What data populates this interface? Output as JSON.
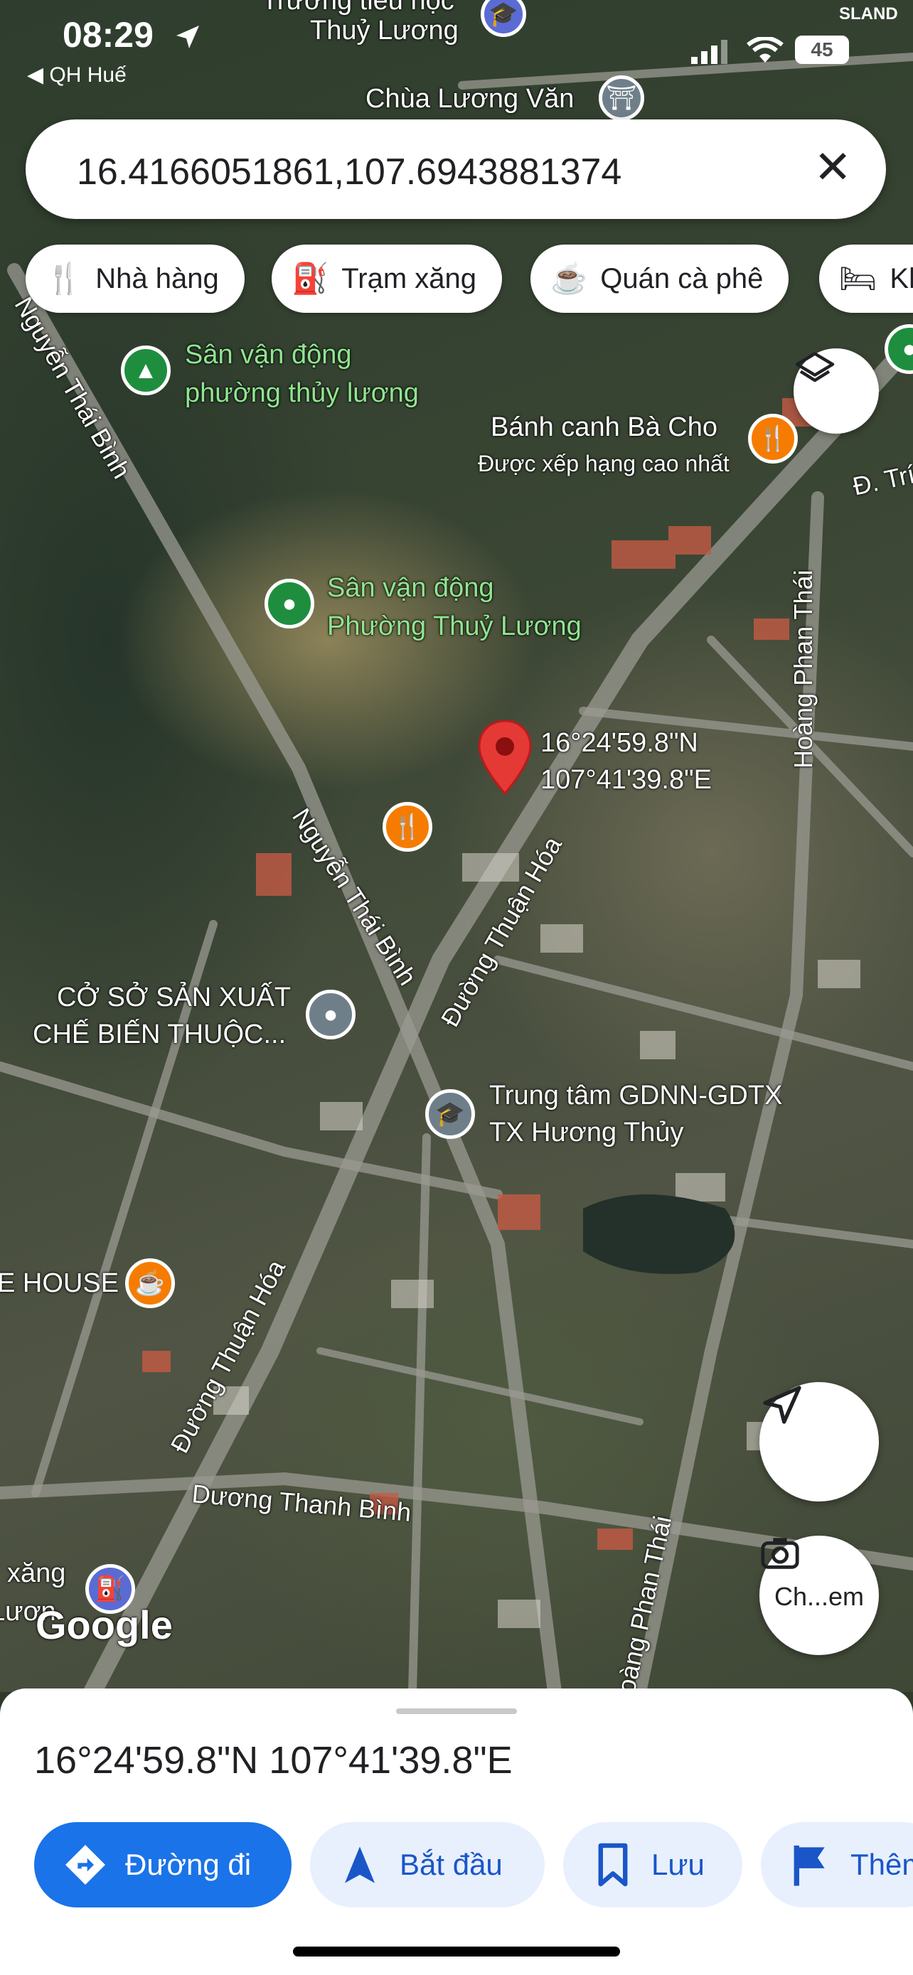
{
  "status_bar": {
    "time": "08:29",
    "back_app": "QH Huế",
    "battery": "45",
    "brand": "SLAND"
  },
  "search": {
    "query": "16.4166051861,107.6943881374"
  },
  "chips": [
    {
      "label": "Nhà hàng",
      "icon": "restaurant-icon"
    },
    {
      "label": "Trạm xăng",
      "icon": "gas-station-icon"
    },
    {
      "label": "Quán cà phê",
      "icon": "coffee-icon"
    },
    {
      "label": "Kh",
      "icon": "hotel-icon"
    }
  ],
  "map": {
    "labels": {
      "school_top": "Trường tiểu học",
      "school_top2": "Thuỷ Lương",
      "pagoda": "Chùa Lương Văn",
      "stadium1_l1": "Sân vận động",
      "stadium1_l2": "phường thủy lương",
      "restaurant": "Bánh canh Bà Cho",
      "restaurant_sub": "Được xếp hạng cao nhất",
      "stadium2_l1": "Sân vận động",
      "stadium2_l2": "Phường Thuỷ Lương",
      "pin_lat": "16°24'59.8\"N",
      "pin_lng": "107°41'39.8\"E",
      "factory_l1": "CỞ SỞ SẢN XUẤT",
      "factory_l2": "CHẾ BIẾN THUỘC...",
      "training_l1": "Trung tâm GDNN-GDTX",
      "training_l2": "TX Hương Thủy",
      "house": "E HOUSE",
      "gas": "xăng",
      "gas2": "Lươn",
      "google": "Google"
    },
    "roads": {
      "nguyen_thai_binh": "Nguyễn Thái Bình",
      "nguyen_thai_binh_2": "Nguyễn Thái Bình",
      "thuan_hoa": "Đường Thuận Hóa",
      "thuan_hoa_2": "Đường Thuận Hóa",
      "hoang_phan_thai": "Hoàng Phan Thái",
      "hoang_phan_thai_2": "oàng Phan Thái",
      "duong_thanh_binh": "Dương Thanh Bình",
      "d_tri": "Đ. Trí"
    },
    "camera_label": "Ch...em"
  },
  "sheet": {
    "coordinates": "16°24'59.8\"N 107°41'39.8\"E",
    "actions": [
      {
        "label": "Đường đi",
        "icon": "directions-icon"
      },
      {
        "label": "Bắt đầu",
        "icon": "navigation-arrow-icon"
      },
      {
        "label": "Lưu",
        "icon": "bookmark-icon"
      },
      {
        "label": "Thêm",
        "icon": "flag-icon"
      }
    ]
  }
}
